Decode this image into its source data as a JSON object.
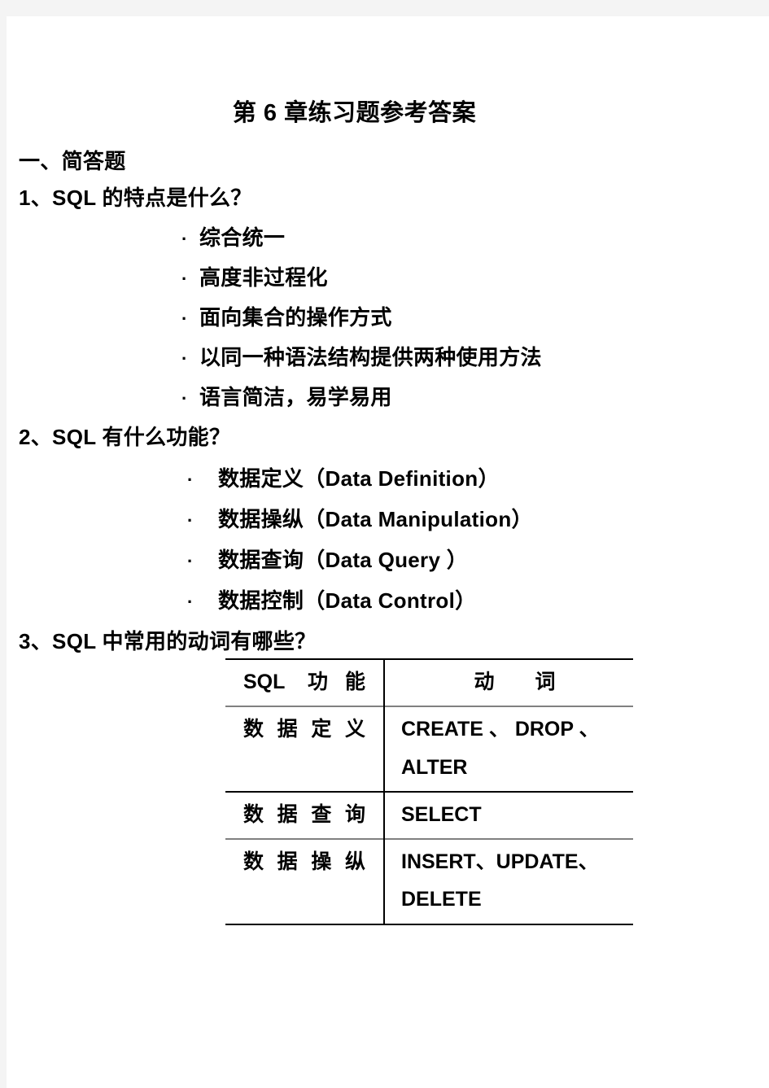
{
  "page": {
    "title": "第 6 章练习题参考答案",
    "section_heading": "一、简答题"
  },
  "questions": [
    {
      "number_label": "1、SQL 的特点是什么？",
      "bullets": [
        "综合统一",
        "高度非过程化",
        "面向集合的操作方式",
        "以同一种语法结构提供两种使用方法",
        "语言简洁，易学易用"
      ]
    },
    {
      "number_label": "2、SQL 有什么功能？",
      "bullets": [
        "数据定义（Data Definition）",
        "数据操纵（Data Manipulation）",
        "数据查询（Data Query ）",
        "数据控制（Data Control）"
      ]
    },
    {
      "number_label": "3、SQL 中常用的动词有哪些？"
    }
  ],
  "bullet_glyph": "·",
  "verbs_table": {
    "headers": [
      "SQL 功能",
      "动　　词"
    ],
    "rows": [
      {
        "function": "数据定义",
        "verbs": "CREATE 、 DROP 、 ALTER"
      },
      {
        "function": "数据查询",
        "verbs": "SELECT"
      },
      {
        "function": "数据操纵",
        "verbs": "INSERT、UPDATE、DELETE"
      }
    ]
  },
  "colors": {
    "page_background": "#ffffff",
    "canvas_background": "#f4f4f4",
    "text": "#000000",
    "rule_dark": "#000000",
    "rule_light": "#808080"
  }
}
